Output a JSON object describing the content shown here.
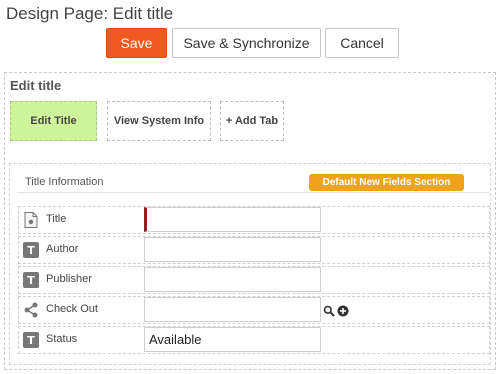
{
  "header": {
    "title": "Design Page: Edit title"
  },
  "toolbar": {
    "save_label": "Save",
    "sync_label": "Save & Synchronize",
    "cancel_label": "Cancel"
  },
  "panel": {
    "title": "Edit title"
  },
  "tabs": [
    {
      "label": "Edit Title",
      "active": true
    },
    {
      "label": "View System Info",
      "active": false
    },
    {
      "label": "+ Add Tab",
      "active": false
    }
  ],
  "section": {
    "title": "Title Information",
    "badge": "Default New Fields Section"
  },
  "fields": [
    {
      "label": "Title",
      "icon": "document-icon",
      "value": "",
      "required": true
    },
    {
      "label": "Author",
      "icon": "text-type-icon",
      "value": ""
    },
    {
      "label": "Publisher",
      "icon": "text-type-icon",
      "value": ""
    },
    {
      "label": "Check Out",
      "icon": "share-icon",
      "value": ""
    },
    {
      "label": "Status",
      "icon": "text-type-icon",
      "value": "Available"
    }
  ],
  "icons": {
    "text_type_glyph": "T"
  },
  "colors": {
    "save_button": "#f15a1f",
    "active_tab": "#cff59a",
    "badge": "#f0a21a",
    "required_marker": "#9a1b1b"
  }
}
